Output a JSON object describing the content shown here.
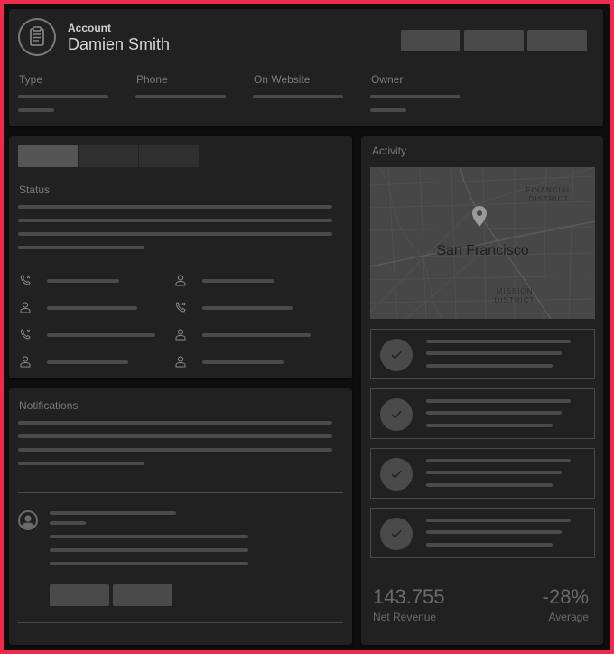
{
  "account": {
    "label": "Account",
    "name": "Damien Smith",
    "fields": [
      {
        "label": "Type"
      },
      {
        "label": "Phone"
      },
      {
        "label": "On Website"
      },
      {
        "label": "Owner"
      }
    ]
  },
  "status": {
    "title": "Status"
  },
  "notifications": {
    "title": "Notifications"
  },
  "activity": {
    "title": "Activity",
    "map": {
      "city": "San Francisco",
      "district_1": "FINANCIAL\nDISTRICT",
      "district_2": "MISSION\nDISTRICT"
    }
  },
  "metrics": [
    {
      "value": "143.755",
      "label": "Net Revenue"
    },
    {
      "value": "-28%",
      "label": "Average"
    }
  ],
  "colors": {
    "frame": "#ee2a4b",
    "panel": "#212121",
    "placeholder": "#4a4a4a"
  },
  "icons": [
    "clipboard-icon",
    "phone-missed-icon",
    "person-icon",
    "map-pin-icon",
    "check-icon",
    "avatar-icon"
  ]
}
